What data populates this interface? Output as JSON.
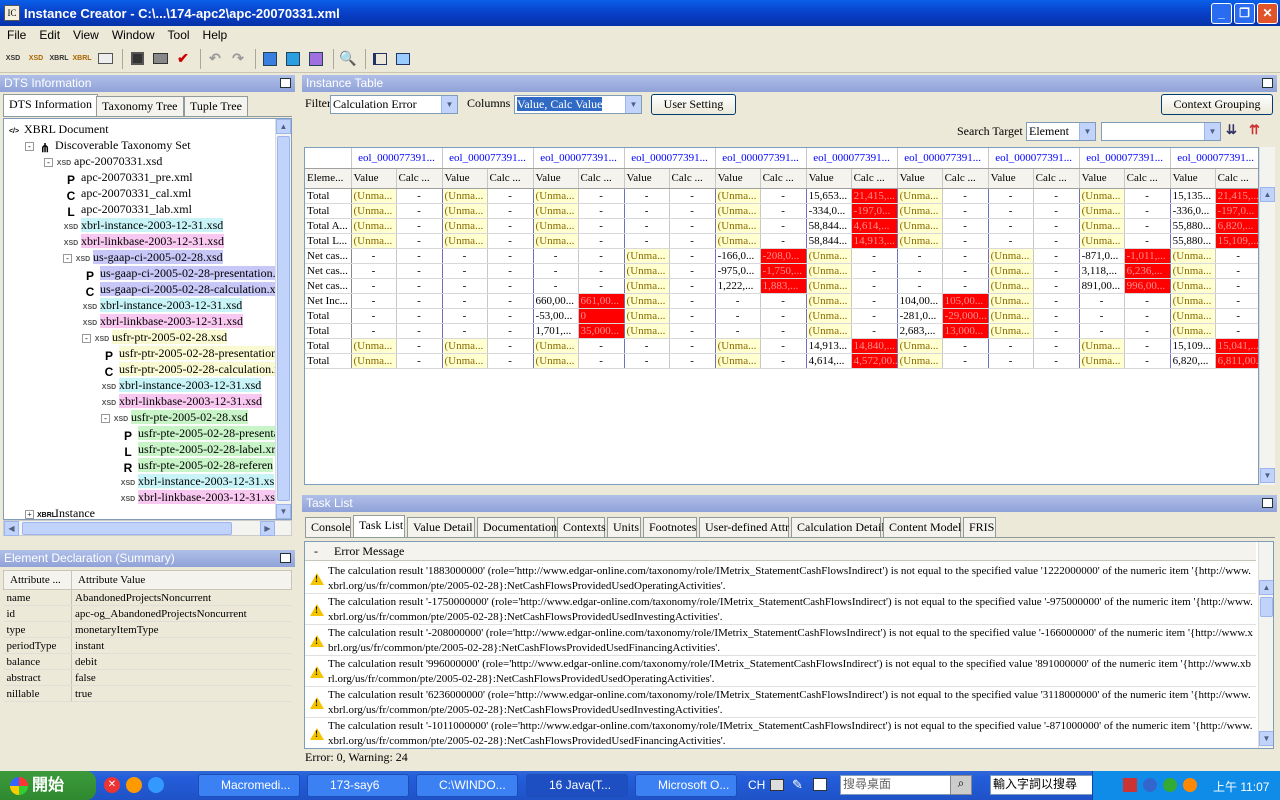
{
  "window": {
    "title": "Instance Creator - C:\\...\\174-apc2\\apc-20070331.xml",
    "min": "_",
    "max": "❐",
    "close": "✕"
  },
  "menu": [
    "File",
    "Edit",
    "View",
    "Window",
    "Tool",
    "Help"
  ],
  "toolbar_icons": [
    "xsd-icon",
    "xsd-new-icon",
    "xbrl-icon",
    "xbrl-new-icon",
    "table-icon",
    "save-icon",
    "print-icon",
    "validate-icon",
    "undo-icon",
    "redo-icon",
    "add-icon",
    "add-context-icon",
    "add-unit-icon",
    "inspect-icon",
    "export-icon",
    "import-icon"
  ],
  "dts": {
    "header": "DTS Information",
    "tabs": [
      "DTS Information",
      "Taxonomy Tree",
      "Tuple Tree"
    ],
    "tree": [
      {
        "label": "XBRL Document",
        "icon": "xbrl-doc-icon",
        "glyph": "</>",
        "level": 0,
        "bg": ""
      },
      {
        "label": "Discoverable Taxonomy Set",
        "icon": "dts-icon",
        "glyph": "⋔",
        "level": 1,
        "bg": "",
        "box": "-"
      },
      {
        "label": "apc-20070331.xsd",
        "icon": "xsd-file-icon",
        "glyph": "XSD",
        "level": 2,
        "bg": "",
        "box": "-"
      },
      {
        "label": "apc-20070331_pre.xml",
        "icon": "presentation-icon",
        "glyph": "P",
        "level": 3,
        "bg": ""
      },
      {
        "label": "apc-20070331_cal.xml",
        "icon": "calculation-icon",
        "glyph": "C",
        "level": 3,
        "bg": ""
      },
      {
        "label": "apc-20070331_lab.xml",
        "icon": "label-icon",
        "glyph": "L",
        "level": 3,
        "bg": ""
      },
      {
        "label": "xbrl-instance-2003-12-31.xsd",
        "icon": "xsd-file-icon",
        "glyph": "XSD",
        "level": 3,
        "bg": "#c8f4f8"
      },
      {
        "label": "xbrl-linkbase-2003-12-31.xsd",
        "icon": "xsd-file-icon",
        "glyph": "XSD",
        "level": 3,
        "bg": "#f8c8f0"
      },
      {
        "label": "us-gaap-ci-2005-02-28.xsd",
        "icon": "xsd-file-icon",
        "glyph": "XSD",
        "level": 3,
        "bg": "#c8c8f8",
        "box": "-"
      },
      {
        "label": "us-gaap-ci-2005-02-28-presentation.x",
        "icon": "presentation-icon",
        "glyph": "P",
        "level": 4,
        "bg": "#c8c8f8"
      },
      {
        "label": "us-gaap-ci-2005-02-28-calculation.x",
        "icon": "calculation-icon",
        "glyph": "C",
        "level": 4,
        "bg": "#c8c8f8"
      },
      {
        "label": "xbrl-instance-2003-12-31.xsd",
        "icon": "xsd-file-icon",
        "glyph": "XSD",
        "level": 4,
        "bg": "#c8f4f8"
      },
      {
        "label": "xbrl-linkbase-2003-12-31.xsd",
        "icon": "xsd-file-icon",
        "glyph": "XSD",
        "level": 4,
        "bg": "#f8c8f0"
      },
      {
        "label": "usfr-ptr-2005-02-28.xsd",
        "icon": "xsd-file-icon",
        "glyph": "XSD",
        "level": 4,
        "bg": "#fafad2",
        "box": "-"
      },
      {
        "label": "usfr-ptr-2005-02-28-presentation",
        "icon": "presentation-icon",
        "glyph": "P",
        "level": 5,
        "bg": "#fafad2"
      },
      {
        "label": "usfr-ptr-2005-02-28-calculation.x",
        "icon": "calculation-icon",
        "glyph": "C",
        "level": 5,
        "bg": "#fafad2"
      },
      {
        "label": "xbrl-instance-2003-12-31.xsd",
        "icon": "xsd-file-icon",
        "glyph": "XSD",
        "level": 5,
        "bg": "#c8f4f8"
      },
      {
        "label": "xbrl-linkbase-2003-12-31.xsd",
        "icon": "xsd-file-icon",
        "glyph": "XSD",
        "level": 5,
        "bg": "#f8c8f0"
      },
      {
        "label": "usfr-pte-2005-02-28.xsd",
        "icon": "xsd-file-icon",
        "glyph": "XSD",
        "level": 5,
        "bg": "#c8f4c8",
        "box": "-"
      },
      {
        "label": "usfr-pte-2005-02-28-presentat",
        "icon": "presentation-icon",
        "glyph": "P",
        "level": 6,
        "bg": "#c8f4c8"
      },
      {
        "label": "usfr-pte-2005-02-28-label.xr",
        "icon": "label-icon",
        "glyph": "L",
        "level": 6,
        "bg": "#c8f4c8"
      },
      {
        "label": "usfr-pte-2005-02-28-referen",
        "icon": "reference-icon",
        "glyph": "R",
        "level": 6,
        "bg": "#c8f4c8"
      },
      {
        "label": "xbrl-instance-2003-12-31.xs",
        "icon": "xsd-file-icon",
        "glyph": "XSD",
        "level": 6,
        "bg": "#c8f4f8"
      },
      {
        "label": "xbrl-linkbase-2003-12-31.xs",
        "icon": "xsd-file-icon",
        "glyph": "XSD",
        "level": 6,
        "bg": "#f8c8f0"
      },
      {
        "label": "Instance",
        "icon": "instance-icon",
        "glyph": "XBRL",
        "level": 1,
        "bg": "",
        "box": "+"
      }
    ]
  },
  "element_decl": {
    "header": "Element Declaration (Summary)",
    "col_attr": "Attribute ...",
    "col_val": "Attribute Value",
    "rows": [
      [
        "name",
        "AbandonedProjectsNoncurrent"
      ],
      [
        "id",
        "apc-og_AbandonedProjectsNoncurrent"
      ],
      [
        "type",
        "monetaryItemType"
      ],
      [
        "periodType",
        "instant"
      ],
      [
        "balance",
        "debit"
      ],
      [
        "abstract",
        "false"
      ],
      [
        "nillable",
        "true"
      ]
    ]
  },
  "instance": {
    "header": "Instance Table",
    "filter_label": "Filter",
    "filter_value": "Calculation Error",
    "columns_label": "Columns",
    "columns_value": "Value, Calc Value",
    "user_setting": "User Setting",
    "context_grouping": "Context Grouping",
    "search_label": "Search Target",
    "search_target": "Element",
    "search_value": "",
    "context_label": "eol_000077391...",
    "elem_hdr": "Eleme...",
    "value_hdr": "Value",
    "calc_hdr": "Calc ...",
    "rows": [
      [
        "Total",
        "U",
        "-",
        "U",
        "-",
        "U",
        "-",
        "-",
        "-",
        "U",
        "-",
        "15,653...",
        "R:21,415,...",
        "U",
        "-",
        "-",
        "-",
        "U",
        "-",
        "15,135...",
        "R:21,415,..."
      ],
      [
        "Total",
        "U",
        "-",
        "U",
        "-",
        "U",
        "-",
        "-",
        "-",
        "U",
        "-",
        "-334,0...",
        "R:-197,0...",
        "U",
        "-",
        "-",
        "-",
        "U",
        "-",
        "-336,0...",
        "R:-197,0..."
      ],
      [
        "Total A...",
        "U",
        "-",
        "U",
        "-",
        "U",
        "-",
        "-",
        "-",
        "U",
        "-",
        "58,844...",
        "R:4,614,...",
        "U",
        "-",
        "-",
        "-",
        "U",
        "-",
        "55,880...",
        "R:6,820,..."
      ],
      [
        "Total L...",
        "U",
        "-",
        "U",
        "-",
        "U",
        "-",
        "-",
        "-",
        "U",
        "-",
        "58,844...",
        "R:14,913,...",
        "U",
        "-",
        "-",
        "-",
        "U",
        "-",
        "55,880...",
        "R:15,109,..."
      ],
      [
        "Net cas...",
        "-",
        "-",
        "-",
        "-",
        "-",
        "-",
        "U",
        "-",
        "-166,0...",
        "R:-208,0...",
        "U",
        "-",
        "-",
        "-",
        "U",
        "-",
        "-871,0...",
        "R:-1,011,...",
        "U",
        "-"
      ],
      [
        "Net cas...",
        "-",
        "-",
        "-",
        "-",
        "-",
        "-",
        "U",
        "-",
        "-975,0...",
        "R:-1,750,...",
        "U",
        "-",
        "-",
        "-",
        "U",
        "-",
        "3,118,...",
        "R:6,236,...",
        "U",
        "-"
      ],
      [
        "Net cas...",
        "-",
        "-",
        "-",
        "-",
        "-",
        "-",
        "U",
        "-",
        "1,222,...",
        "R:1,883,...",
        "U",
        "-",
        "-",
        "-",
        "U",
        "-",
        "891,00...",
        "R:996,00...",
        "U",
        "-"
      ],
      [
        "Net Inc...",
        "-",
        "-",
        "-",
        "-",
        "660,00...",
        "R:661,00...",
        "U",
        "-",
        "-",
        "-",
        "U",
        "-",
        "104,00...",
        "R:105,00...",
        "U",
        "-",
        "-",
        "-",
        "U",
        "-"
      ],
      [
        "Total",
        "-",
        "-",
        "-",
        "-",
        "-53,00...",
        "R:0",
        "U",
        "-",
        "-",
        "-",
        "U",
        "-",
        "-281,0...",
        "R:-29,000...",
        "U",
        "-",
        "-",
        "-",
        "U",
        "-"
      ],
      [
        "Total",
        "-",
        "-",
        "-",
        "-",
        "1,701,...",
        "R:35,000...",
        "U",
        "-",
        "-",
        "-",
        "U",
        "-",
        "2,683,...",
        "R:13,000...",
        "U",
        "-",
        "-",
        "-",
        "U",
        "-"
      ],
      [
        "Total",
        "U",
        "-",
        "U",
        "-",
        "U",
        "-",
        "-",
        "-",
        "U",
        "-",
        "14,913...",
        "R:14,840,...",
        "U",
        "-",
        "-",
        "-",
        "U",
        "-",
        "15,109...",
        "R:15,041,..."
      ],
      [
        "Total",
        "U",
        "-",
        "U",
        "-",
        "U",
        "-",
        "-",
        "-",
        "U",
        "-",
        "4,614,...",
        "R:4,572,00...",
        "U",
        "-",
        "-",
        "-",
        "U",
        "-",
        "6,820,...",
        "R:6,811,00..."
      ]
    ],
    "unmatched": "(Unma..."
  },
  "tasks": {
    "header": "Task List",
    "tabs": [
      "Console",
      "Task List",
      "Value Detail",
      "Documentation",
      "Contexts",
      "Units",
      "Footnotes",
      "User-defined Attr",
      "Calculation Detail",
      "Content Model",
      "FRIS"
    ],
    "col_dash": "-",
    "col_msg": "Error Message",
    "messages": [
      "The calculation result '1883000000' (role='http://www.edgar-online.com/taxonomy/role/IMetrix_StatementCashFlowsIndirect') is not equal to the specified value '1222000000' of the numeric item '{http://www.xbrl.org/us/fr/common/pte/2005-02-28}:NetCashFlowsProvidedUsedOperatingActivities'.",
      "The calculation result '-1750000000' (role='http://www.edgar-online.com/taxonomy/role/IMetrix_StatementCashFlowsIndirect') is not equal to the specified value '-975000000' of the numeric item '{http://www.xbrl.org/us/fr/common/pte/2005-02-28}:NetCashFlowsProvidedUsedInvestingActivities'.",
      "The calculation result '-208000000' (role='http://www.edgar-online.com/taxonomy/role/IMetrix_StatementCashFlowsIndirect') is not equal to the specified value '-166000000' of the numeric item '{http://www.xbrl.org/us/fr/common/pte/2005-02-28}:NetCashFlowsProvidedUsedFinancingActivities'.",
      "The calculation result '996000000' (role='http://www.edgar-online.com/taxonomy/role/IMetrix_StatementCashFlowsIndirect') is not equal to the specified value '891000000' of the numeric item '{http://www.xbrl.org/us/fr/common/pte/2005-02-28}:NetCashFlowsProvidedUsedOperatingActivities'.",
      "The calculation result '6236000000' (role='http://www.edgar-online.com/taxonomy/role/IMetrix_StatementCashFlowsIndirect') is not equal to the specified value '3118000000' of the numeric item '{http://www.xbrl.org/us/fr/common/pte/2005-02-28}:NetCashFlowsProvidedUsedInvestingActivities'.",
      "The calculation result '-1011000000' (role='http://www.edgar-online.com/taxonomy/role/IMetrix_StatementCashFlowsIndirect') is not equal to the specified value '-871000000' of the numeric item '{http://www.xbrl.org/us/fr/common/pte/2005-02-28}:NetCashFlowsProvidedUsedFinancingActivities'."
    ],
    "status": "Error: 0, Warning: 24"
  },
  "taskbar": {
    "start": "開始",
    "tasks": [
      "Macromedi...",
      "173-say6",
      "C:\\WINDO...",
      "16 Java(T...",
      "Microsoft O..."
    ],
    "lang": "CH",
    "search_placeholder": "搜尋桌面",
    "input_hint": "輸入字詞以搜尋",
    "clock": "上午 11:07"
  }
}
